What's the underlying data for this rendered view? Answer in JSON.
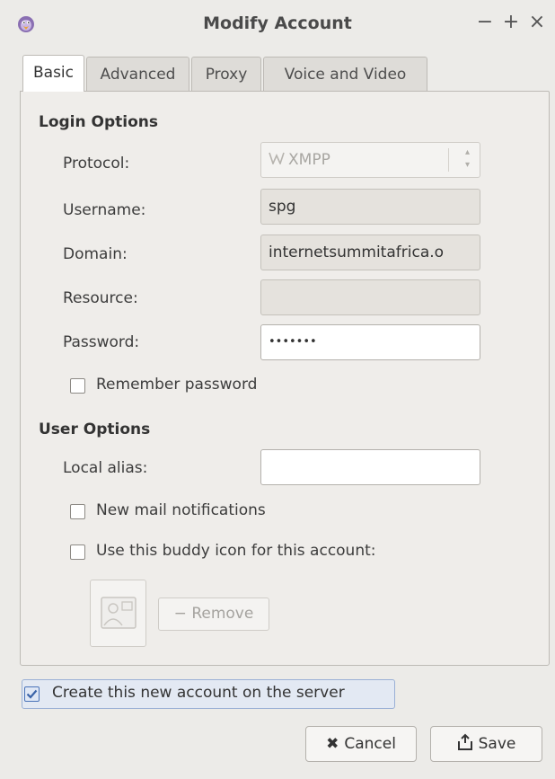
{
  "window": {
    "title": "Modify Account",
    "minimize": "−",
    "maximize": "+",
    "close": "×"
  },
  "tabs": [
    {
      "label": "Basic"
    },
    {
      "label": "Advanced"
    },
    {
      "label": "Proxy"
    },
    {
      "label": "Voice and Video"
    }
  ],
  "login": {
    "section_title": "Login Options",
    "protocol_label": "Protocol:",
    "protocol_value": "XMPP",
    "username_label": "Username:",
    "username_value": "spg",
    "domain_label": "Domain:",
    "domain_value": "internetsummitafrica.o",
    "resource_label": "Resource:",
    "resource_value": "",
    "password_label": "Password:",
    "password_value": "•••••••",
    "remember_label": "Remember password"
  },
  "user": {
    "section_title": "User Options",
    "alias_label": "Local alias:",
    "alias_value": "",
    "mail_label": "New mail notifications",
    "buddy_label": "Use this buddy icon for this account:",
    "remove_label": "Remove",
    "remove_icon": "−"
  },
  "create_account_label": "Create this new account on the server",
  "buttons": {
    "cancel": "Cancel",
    "cancel_icon": "✖",
    "save": "Save"
  },
  "colors": {
    "accent": "#4a73b8",
    "background": "#ecebe8"
  }
}
